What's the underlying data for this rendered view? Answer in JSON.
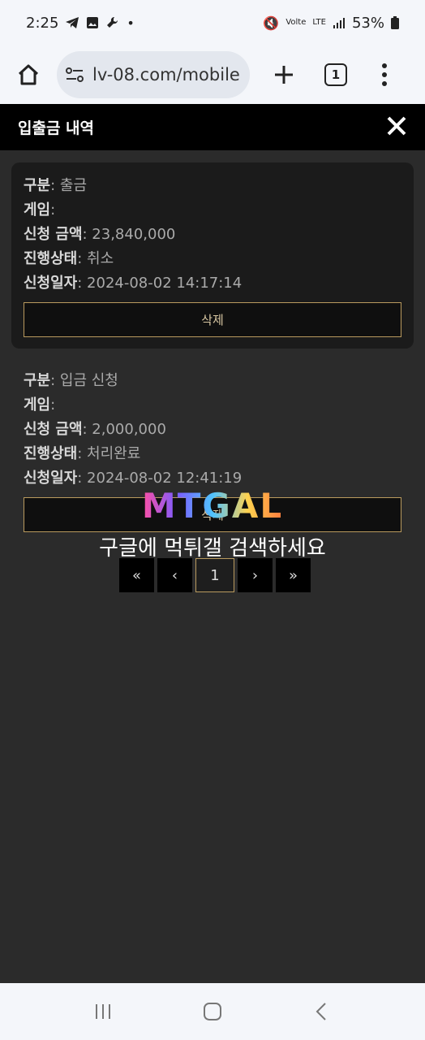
{
  "status_bar": {
    "time": "2:25",
    "battery": "53%",
    "network": "LTE"
  },
  "browser": {
    "url": "lv-08.com/mobile",
    "tab_count": "1"
  },
  "modal": {
    "title": "입출금 내역"
  },
  "records": [
    {
      "type_label": "구분",
      "type_value": ": 출금",
      "game_label": "게임",
      "game_value": ":",
      "amount_label": "신청 금액",
      "amount_value": ": 23,840,000",
      "status_label": "진행상태",
      "status_value": ": 취소",
      "date_label": "신청일자",
      "date_value": ": 2024-08-02 14:17:14",
      "delete_label": "삭제"
    },
    {
      "type_label": "구분",
      "type_value": ": 입금 신청",
      "game_label": "게임",
      "game_value": ":",
      "amount_label": "신청 금액",
      "amount_value": ": 2,000,000",
      "status_label": "진행상태",
      "status_value": ": 처리완료",
      "date_label": "신청일자",
      "date_value": ": 2024-08-02 12:41:19",
      "delete_label": "삭제"
    }
  ],
  "pagination": {
    "first": "«",
    "prev": "‹",
    "current": "1",
    "next": "›",
    "last": "»"
  },
  "watermark": {
    "logo": "MTGAL",
    "caption": "구글에 먹튀갤 검색하세요"
  },
  "colors": {
    "gold_border": "#b99a5e",
    "modal_bg": "#2b2b2b",
    "header_bg": "#000000"
  }
}
